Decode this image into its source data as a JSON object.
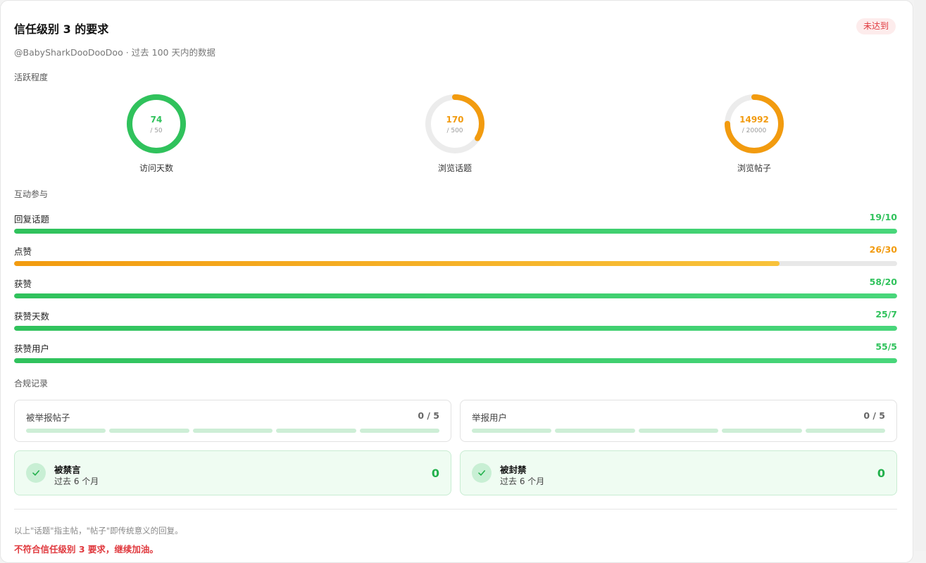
{
  "header": {
    "title": "信任级别 3 的要求",
    "badge": "未达到",
    "subtitle": "@BabySharkDooDooDoo · 过去 100 天内的数据"
  },
  "colors": {
    "green": "#30c25c",
    "orange": "#f29b0f",
    "red": "#e0393e",
    "track": "#ececec"
  },
  "activity": {
    "label": "活跃程度",
    "rings": [
      {
        "value": "74",
        "target": "/ 50",
        "caption": "访问天数",
        "progress": 1.0,
        "color": "green"
      },
      {
        "value": "170",
        "target": "/ 500",
        "caption": "浏览话题",
        "progress": 0.34,
        "color": "orange"
      },
      {
        "value": "14992",
        "target": "/ 20000",
        "caption": "浏览帖子",
        "progress": 0.75,
        "color": "orange"
      }
    ]
  },
  "interaction": {
    "label": "互动参与",
    "bars": [
      {
        "name": "回复话题",
        "value": "19/10",
        "progress": 1.0,
        "color": "green"
      },
      {
        "name": "点赞",
        "value": "26/30",
        "progress": 0.867,
        "color": "orange"
      },
      {
        "name": "获赞",
        "value": "58/20",
        "progress": 1.0,
        "color": "green"
      },
      {
        "name": "获赞天数",
        "value": "25/7",
        "progress": 1.0,
        "color": "green"
      },
      {
        "name": "获赞用户",
        "value": "55/5",
        "progress": 1.0,
        "color": "green"
      }
    ]
  },
  "compliance": {
    "label": "合规记录",
    "boxes": [
      {
        "name": "被举报帖子",
        "value": "0 / 5"
      },
      {
        "name": "举报用户",
        "value": "0 / 5"
      }
    ],
    "status": [
      {
        "title": "被禁言",
        "sub": "过去 6 个月",
        "value": "0"
      },
      {
        "title": "被封禁",
        "sub": "过去 6 个月",
        "value": "0"
      }
    ]
  },
  "footer": {
    "note": "以上\"话题\"指主帖，\"帖子\"即传统意义的回复。",
    "warning": "不符合信任级别 3 要求，继续加油。"
  }
}
